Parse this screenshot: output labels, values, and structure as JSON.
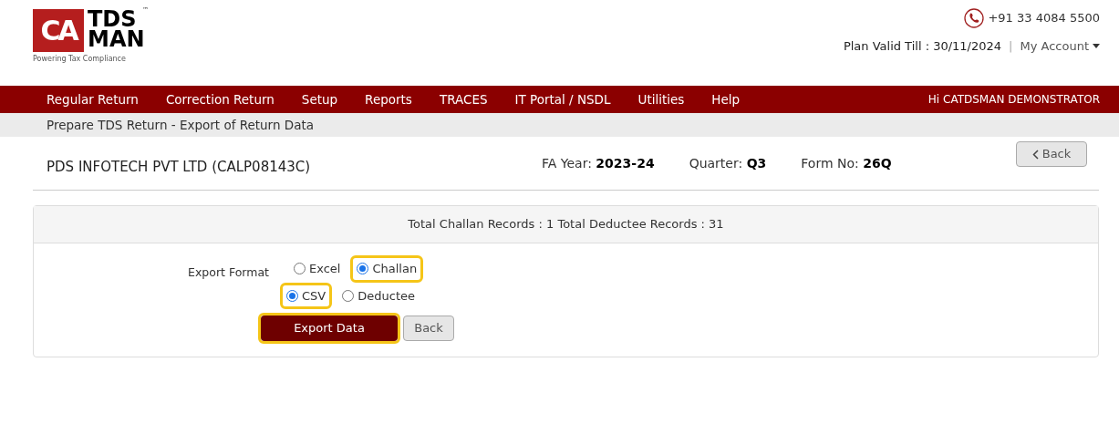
{
  "logo": {
    "mark": "CA",
    "line1": "TDS",
    "line2": "MAN",
    "trademark": "™",
    "tagline": "Powering Tax Compliance"
  },
  "header": {
    "phone": "+91 33 4084 5500",
    "plan": "Plan Valid Till : 30/11/2024",
    "separator": "|",
    "account": "My Account"
  },
  "nav": {
    "items": [
      {
        "label": "Regular Return"
      },
      {
        "label": "Correction Return"
      },
      {
        "label": "Setup"
      },
      {
        "label": "Reports"
      },
      {
        "label": "TRACES"
      },
      {
        "label": "IT Portal / NSDL"
      },
      {
        "label": "Utilities"
      },
      {
        "label": "Help"
      }
    ],
    "greeting": "Hi CATDSMAN DEMONSTRATOR"
  },
  "breadcrumb": "Prepare TDS Return - Export of Return Data",
  "title_row": {
    "company": "PDS INFOTECH PVT LTD (CALP08143C)",
    "fields": [
      {
        "label": "FA Year:",
        "value": "2023-24"
      },
      {
        "label": "Quarter:",
        "value": "Q3"
      },
      {
        "label": "Form No:",
        "value": "26Q"
      }
    ],
    "back": "Back"
  },
  "panel": {
    "summary": "Total Challan Records : 1 Total Deductee Records : 31",
    "export_format_label": "Export Format",
    "option_rows": [
      [
        {
          "label": "Excel",
          "selected": false,
          "highlighted": false
        },
        {
          "label": "Challan",
          "selected": true,
          "highlighted": true
        }
      ],
      [
        {
          "label": "CSV",
          "selected": true,
          "highlighted": true
        },
        {
          "label": "Deductee",
          "selected": false,
          "highlighted": false
        }
      ]
    ],
    "buttons": [
      {
        "label": "Export Data",
        "kind": "primary",
        "highlighted": true
      },
      {
        "label": "Back",
        "kind": "secondary",
        "highlighted": false
      }
    ]
  }
}
